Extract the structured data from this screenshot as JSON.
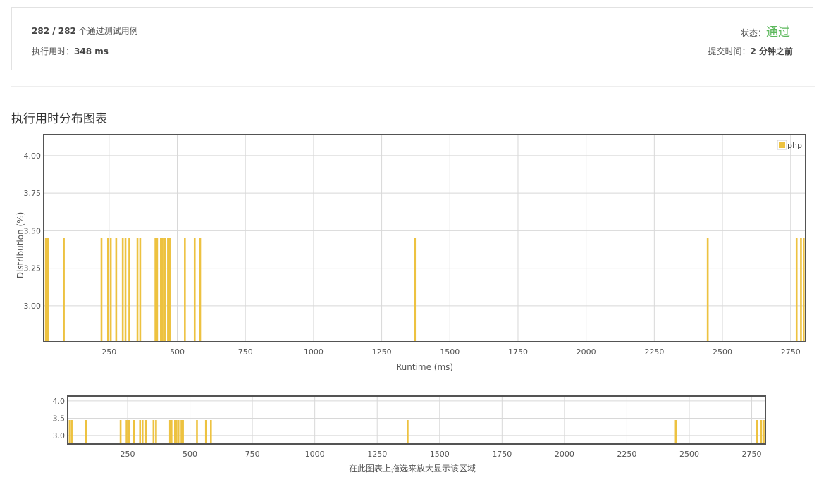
{
  "summary": {
    "passed": "282 / 282",
    "passed_suffix": " 个通过测试用例",
    "runtime_label": "执行用时：",
    "runtime_value": "348 ms",
    "status_label": "状态：",
    "status_value": "通过",
    "submit_label": "提交时间：",
    "submit_value": "2 分钟之前"
  },
  "section_title": "执行用时分布图表",
  "overview_hint": "在此图表上拖选来放大显示该区域",
  "colors": {
    "bar": "#edc240",
    "grid": "#d8d8d8",
    "frame": "#545454",
    "status": "#5cb85c"
  },
  "chart_data": [
    {
      "type": "bar",
      "name": "main",
      "xlabel": "Runtime (ms)",
      "ylabel": "Distribution (%)",
      "xlim": [
        10,
        2805
      ],
      "ylim": [
        2.76,
        4.14
      ],
      "xticks": [
        250,
        500,
        750,
        1000,
        1250,
        1500,
        1750,
        2000,
        2250,
        2500,
        2750
      ],
      "yticks": [
        3.0,
        3.25,
        3.5,
        3.75,
        4.0
      ],
      "ytick_labels": [
        "3.00",
        "3.25",
        "3.50",
        "3.75",
        "4.00"
      ],
      "grid": true,
      "legend": "top-right",
      "series": [
        {
          "name": "php",
          "x": [
            18,
            26,
            84,
            222,
            246,
            256,
            276,
            300,
            310,
            324,
            354,
            364,
            420,
            426,
            440,
            446,
            454,
            466,
            472,
            528,
            564,
            584,
            1372,
            2446,
            2772,
            2788,
            2798
          ],
          "values": [
            3.45,
            3.45,
            3.45,
            3.45,
            3.45,
            3.45,
            3.45,
            3.45,
            3.45,
            3.45,
            3.45,
            3.45,
            3.45,
            3.45,
            3.45,
            3.45,
            3.45,
            3.45,
            3.45,
            3.45,
            3.45,
            3.45,
            3.45,
            3.45,
            3.45,
            3.45,
            3.45
          ]
        }
      ]
    },
    {
      "type": "bar",
      "name": "overview",
      "xlim": [
        10,
        2805
      ],
      "ylim": [
        2.76,
        4.14
      ],
      "xticks": [
        250,
        500,
        750,
        1000,
        1250,
        1500,
        1750,
        2000,
        2250,
        2500,
        2750
      ],
      "yticks": [
        3.0,
        3.5,
        4.0
      ],
      "ytick_labels": [
        "3.0",
        "3.5",
        "4.0"
      ],
      "grid": true,
      "series": [
        {
          "name": "",
          "x": [
            18,
            26,
            84,
            222,
            246,
            256,
            276,
            300,
            310,
            324,
            354,
            364,
            420,
            426,
            440,
            446,
            454,
            466,
            472,
            528,
            564,
            584,
            1372,
            2446,
            2772,
            2788,
            2798
          ],
          "values": [
            3.45,
            3.45,
            3.45,
            3.45,
            3.45,
            3.45,
            3.45,
            3.45,
            3.45,
            3.45,
            3.45,
            3.45,
            3.45,
            3.45,
            3.45,
            3.45,
            3.45,
            3.45,
            3.45,
            3.45,
            3.45,
            3.45,
            3.45,
            3.45,
            3.45,
            3.45,
            3.45
          ]
        }
      ]
    }
  ]
}
